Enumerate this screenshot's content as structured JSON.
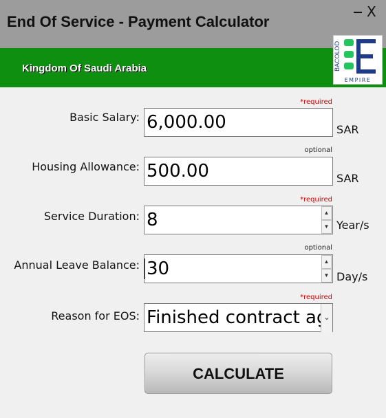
{
  "window": {
    "title": "End Of Service - Payment Calculator",
    "minimize_label": "_",
    "close_label": "X"
  },
  "banner": {
    "country": "Kingdom Of Saudi Arabia",
    "logo_text": "BACOLOD",
    "logo_subtext": "EMPIRE",
    "logo_colors": {
      "green": "#22c55e",
      "blue": "#1e3a8a"
    }
  },
  "form": {
    "basic_salary": {
      "label": "Basic Salary:",
      "hint": "*required",
      "value": "6,000.00",
      "unit": "SAR"
    },
    "housing_allowance": {
      "label": "Housing Allowance:",
      "hint": "optional",
      "value": "500.00",
      "unit": "SAR"
    },
    "service_duration": {
      "label": "Service Duration:",
      "hint": "*required",
      "value": "8",
      "unit": "Year/s"
    },
    "annual_leave": {
      "label": "Annual Leave Balance:",
      "hint": "optional",
      "value": "30",
      "unit": "Day/s"
    },
    "reason": {
      "label": "Reason for EOS:",
      "hint": "*required",
      "value": "Finished contract agreement"
    }
  },
  "actions": {
    "calculate_label": "CALCULATE"
  }
}
